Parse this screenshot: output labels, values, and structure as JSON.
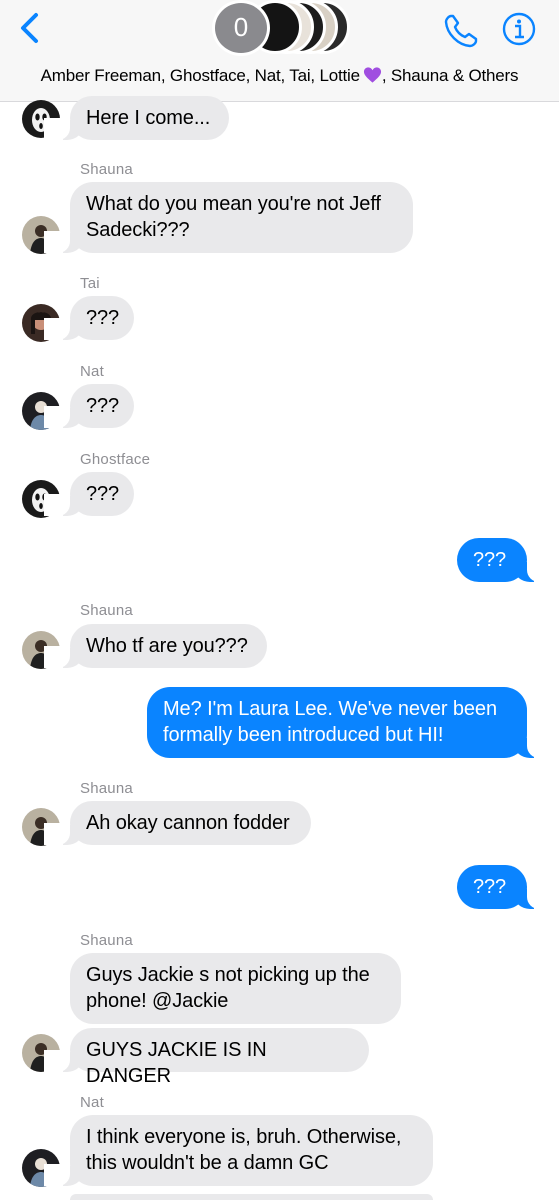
{
  "header": {
    "group_count": "0",
    "title": "Amber Freeman, Ghostface, Nat, Tai, Lottie",
    "title_suffix": ", Shauna & Others",
    "icons": [
      "chevron-left-icon",
      "phone-icon",
      "info-icon",
      "purple-heart-icon"
    ]
  },
  "colors": {
    "accent": "#0a84ff",
    "incoming_bubble": "#e9e9eb",
    "sender_label": "#8e8e93",
    "header_bg": "#f7f7f7"
  },
  "messages": [
    {
      "sender": "",
      "text": "Here I come...",
      "direction": "incoming"
    },
    {
      "sender": "Shauna",
      "text": "What do you mean you're not Jeff Sadecki???",
      "direction": "incoming"
    },
    {
      "sender": "Tai",
      "text": "???",
      "direction": "incoming"
    },
    {
      "sender": "Nat",
      "text": "???",
      "direction": "incoming"
    },
    {
      "sender": "Ghostface",
      "text": "???",
      "direction": "incoming"
    },
    {
      "sender": "",
      "text": "???",
      "direction": "outgoing"
    },
    {
      "sender": "Shauna",
      "text": "Who tf are you???",
      "direction": "incoming"
    },
    {
      "sender": "",
      "text": "Me? I'm Laura Lee. We've never been formally been introduced but HI!",
      "direction": "outgoing"
    },
    {
      "sender": "Shauna",
      "text": "Ah okay cannon fodder",
      "direction": "incoming"
    },
    {
      "sender": "",
      "text": "???",
      "direction": "outgoing"
    },
    {
      "sender": "Shauna",
      "text": "Guys Jackie s not picking up the phone! @Jackie",
      "direction": "incoming"
    },
    {
      "sender": "",
      "text": "GUYS JACKIE IS IN DANGER",
      "direction": "incoming"
    },
    {
      "sender": "Nat",
      "text": "I think everyone is, bruh. Otherwise, this wouldn't be a damn GC",
      "direction": "incoming"
    }
  ]
}
